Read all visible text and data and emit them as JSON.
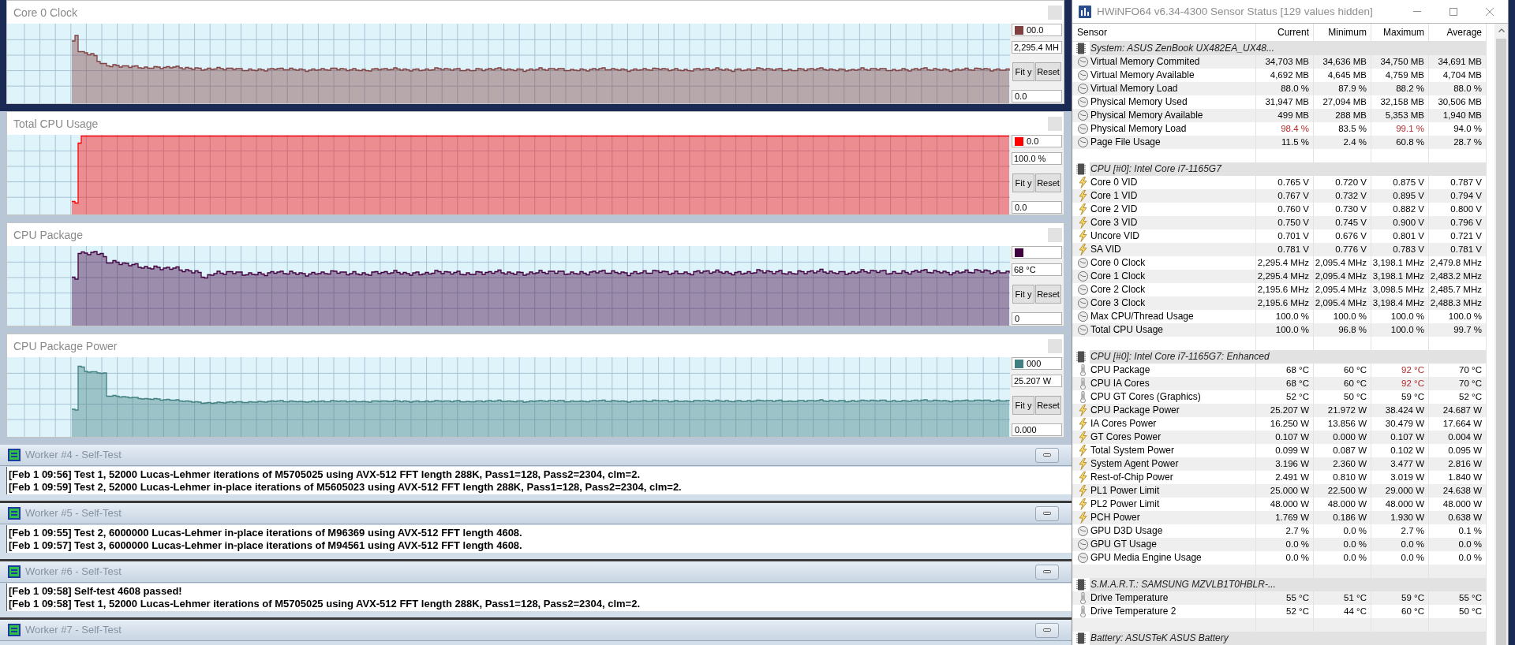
{
  "graphs": [
    {
      "title": "Core 0 Clock",
      "kind": "clock",
      "color": "#804040",
      "scale_max": "00.0",
      "current": "2,295.4 MH",
      "buttons": [
        "Fit y",
        "Reset"
      ],
      "scale_min": "0.0"
    },
    {
      "title": "Total CPU Usage",
      "kind": "usage",
      "color": "#ff0000",
      "scale_max": "0.0",
      "current": "100.0 %",
      "buttons": [
        "Fit y",
        "Reset"
      ],
      "scale_min": "0.0"
    },
    {
      "title": "CPU Package",
      "kind": "temperature",
      "color": "#400040",
      "current": "68 °C",
      "buttons": [
        "Fit y",
        "Reset"
      ],
      "scale_min": "0"
    },
    {
      "title": "CPU Package Power",
      "kind": "power",
      "color": "#408080",
      "scale_max": "000",
      "current": "25.207 W",
      "buttons": [
        "Fit y",
        "Reset"
      ],
      "scale_min": "0.000"
    }
  ],
  "workers": [
    {
      "title": "Worker #4 - Self-Test",
      "lines": [
        "[Feb 1 09:56] Test 1, 52000 Lucas-Lehmer iterations of M5705025 using AVX-512 FFT length 288K, Pass1=128, Pass2=2304, clm=2.",
        "[Feb 1 09:59] Test 2, 52000 Lucas-Lehmer in-place iterations of M5605023 using AVX-512 FFT length 288K, Pass1=128, Pass2=2304, clm=2."
      ]
    },
    {
      "title": "Worker #5 - Self-Test",
      "lines": [
        "[Feb 1 09:55] Test 2, 6000000 Lucas-Lehmer in-place iterations of M96369 using AVX-512 FFT length 4608.",
        "[Feb 1 09:57] Test 3, 6000000 Lucas-Lehmer in-place iterations of M94561 using AVX-512 FFT length 4608."
      ]
    },
    {
      "title": "Worker #6 - Self-Test",
      "lines": [
        "[Feb 1 09:58] Self-test 4608 passed!",
        "[Feb 1 09:58] Test 1, 52000 Lucas-Lehmer iterations of M5705025 using AVX-512 FFT length 288K, Pass1=128, Pass2=2304, clm=2."
      ]
    },
    {
      "title": "Worker #7 - Self-Test"
    }
  ],
  "hwinfo": {
    "title": "HWiNFO64 v6.34-4300 Sensor Status [129 values hidden]",
    "columns": [
      "Sensor",
      "Current",
      "Minimum",
      "Maximum",
      "Average"
    ],
    "sections": [
      {
        "name": "System: ASUS ZenBook UX482EA_UX48...",
        "rows": [
          {
            "kind": "meter",
            "name": "Virtual Memory Commited",
            "values": [
              "34,703 MB",
              "34,636 MB",
              "34,750 MB",
              "34,691 MB"
            ],
            "warnings": [
              false,
              false,
              false,
              false
            ]
          },
          {
            "kind": "meter",
            "name": "Virtual Memory Available",
            "values": [
              "4,692 MB",
              "4,645 MB",
              "4,759 MB",
              "4,704 MB"
            ],
            "warnings": [
              false,
              false,
              false,
              false
            ]
          },
          {
            "kind": "meter",
            "name": "Virtual Memory Load",
            "values": [
              "88.0 %",
              "87.9 %",
              "88.2 %",
              "88.0 %"
            ],
            "warnings": [
              false,
              false,
              false,
              false
            ]
          },
          {
            "kind": "meter",
            "name": "Physical Memory Used",
            "values": [
              "31,947 MB",
              "27,094 MB",
              "32,158 MB",
              "30,506 MB"
            ],
            "warnings": [
              false,
              false,
              false,
              false
            ]
          },
          {
            "kind": "meter",
            "name": "Physical Memory Available",
            "values": [
              "499 MB",
              "288 MB",
              "5,353 MB",
              "1,940 MB"
            ],
            "warnings": [
              false,
              false,
              false,
              false
            ]
          },
          {
            "kind": "meter",
            "name": "Physical Memory Load",
            "values": [
              "98.4 %",
              "83.5 %",
              "99.1 %",
              "94.0 %"
            ],
            "warnings": [
              true,
              false,
              true,
              false
            ]
          },
          {
            "kind": "meter",
            "name": "Page File Usage",
            "values": [
              "11.5 %",
              "2.4 %",
              "60.8 %",
              "28.7 %"
            ],
            "warnings": [
              false,
              false,
              false,
              false
            ]
          }
        ]
      },
      {
        "name": "CPU [#0]: Intel Core i7-1165G7",
        "rows": [
          {
            "kind": "electric",
            "name": "Core 0 VID",
            "values": [
              "0.765 V",
              "0.720 V",
              "0.875 V",
              "0.787 V"
            ],
            "warnings": [
              false,
              false,
              false,
              false
            ]
          },
          {
            "kind": "electric",
            "name": "Core 1 VID",
            "values": [
              "0.767 V",
              "0.732 V",
              "0.895 V",
              "0.794 V"
            ],
            "warnings": [
              false,
              false,
              false,
              false
            ]
          },
          {
            "kind": "electric",
            "name": "Core 2 VID",
            "values": [
              "0.760 V",
              "0.730 V",
              "0.882 V",
              "0.800 V"
            ],
            "warnings": [
              false,
              false,
              false,
              false
            ]
          },
          {
            "kind": "electric",
            "name": "Core 3 VID",
            "values": [
              "0.750 V",
              "0.745 V",
              "0.900 V",
              "0.796 V"
            ],
            "warnings": [
              false,
              false,
              false,
              false
            ]
          },
          {
            "kind": "electric",
            "name": "Uncore VID",
            "values": [
              "0.701 V",
              "0.676 V",
              "0.801 V",
              "0.721 V"
            ],
            "warnings": [
              false,
              false,
              false,
              false
            ]
          },
          {
            "kind": "electric",
            "name": "SA VID",
            "values": [
              "0.781 V",
              "0.776 V",
              "0.783 V",
              "0.781 V"
            ],
            "warnings": [
              false,
              false,
              false,
              false
            ]
          },
          {
            "kind": "meter",
            "name": "Core 0 Clock",
            "values": [
              "2,295.4 MHz",
              "2,095.4 MHz",
              "3,198.1 MHz",
              "2,479.8 MHz"
            ],
            "warnings": [
              false,
              false,
              false,
              false
            ]
          },
          {
            "kind": "meter",
            "name": "Core 1 Clock",
            "values": [
              "2,295.4 MHz",
              "2,095.4 MHz",
              "3,198.1 MHz",
              "2,483.2 MHz"
            ],
            "warnings": [
              false,
              false,
              false,
              false
            ]
          },
          {
            "kind": "meter",
            "name": "Core 2 Clock",
            "values": [
              "2,195.6 MHz",
              "2,095.4 MHz",
              "3,098.5 MHz",
              "2,485.7 MHz"
            ],
            "warnings": [
              false,
              false,
              false,
              false
            ]
          },
          {
            "kind": "meter",
            "name": "Core 3 Clock",
            "values": [
              "2,195.6 MHz",
              "2,095.4 MHz",
              "3,198.4 MHz",
              "2,488.3 MHz"
            ],
            "warnings": [
              false,
              false,
              false,
              false
            ]
          },
          {
            "kind": "meter",
            "name": "Max CPU/Thread Usage",
            "values": [
              "100.0 %",
              "100.0 %",
              "100.0 %",
              "100.0 %"
            ],
            "warnings": [
              false,
              false,
              false,
              false
            ]
          },
          {
            "kind": "meter",
            "name": "Total CPU Usage",
            "values": [
              "100.0 %",
              "96.8 %",
              "100.0 %",
              "99.7 %"
            ],
            "warnings": [
              false,
              false,
              false,
              false
            ]
          }
        ]
      },
      {
        "name": "CPU [#0]: Intel Core i7-1165G7: Enhanced",
        "rows": [
          {
            "kind": "thermal",
            "name": "CPU Package",
            "values": [
              "68 °C",
              "60 °C",
              "92 °C",
              "70 °C"
            ],
            "warnings": [
              false,
              false,
              true,
              false
            ]
          },
          {
            "kind": "thermal",
            "name": "CPU IA Cores",
            "values": [
              "68 °C",
              "60 °C",
              "92 °C",
              "70 °C"
            ],
            "warnings": [
              false,
              false,
              true,
              false
            ]
          },
          {
            "kind": "thermal",
            "name": "CPU GT Cores (Graphics)",
            "values": [
              "52 °C",
              "50 °C",
              "59 °C",
              "52 °C"
            ],
            "warnings": [
              false,
              false,
              false,
              false
            ]
          },
          {
            "kind": "electric",
            "name": "CPU Package Power",
            "values": [
              "25.207 W",
              "21.972 W",
              "38.424 W",
              "24.687 W"
            ],
            "warnings": [
              false,
              false,
              false,
              false
            ]
          },
          {
            "kind": "electric",
            "name": "IA Cores Power",
            "values": [
              "16.250 W",
              "13.856 W",
              "30.479 W",
              "17.664 W"
            ],
            "warnings": [
              false,
              false,
              false,
              false
            ]
          },
          {
            "kind": "electric",
            "name": "GT Cores Power",
            "values": [
              "0.107 W",
              "0.000 W",
              "0.107 W",
              "0.004 W"
            ],
            "warnings": [
              false,
              false,
              false,
              false
            ]
          },
          {
            "kind": "electric",
            "name": "Total System Power",
            "values": [
              "0.099 W",
              "0.087 W",
              "0.102 W",
              "0.095 W"
            ],
            "warnings": [
              false,
              false,
              false,
              false
            ]
          },
          {
            "kind": "electric",
            "name": "System Agent Power",
            "values": [
              "3.196 W",
              "2.360 W",
              "3.477 W",
              "2.816 W"
            ],
            "warnings": [
              false,
              false,
              false,
              false
            ]
          },
          {
            "kind": "electric",
            "name": "Rest-of-Chip Power",
            "values": [
              "2.491 W",
              "0.810 W",
              "3.019 W",
              "1.840 W"
            ],
            "warnings": [
              false,
              false,
              false,
              false
            ]
          },
          {
            "kind": "electric",
            "name": "PL1 Power Limit",
            "values": [
              "25.000 W",
              "22.500 W",
              "29.000 W",
              "24.638 W"
            ],
            "warnings": [
              false,
              false,
              false,
              false
            ]
          },
          {
            "kind": "electric",
            "name": "PL2 Power Limit",
            "values": [
              "48.000 W",
              "48.000 W",
              "48.000 W",
              "48.000 W"
            ],
            "warnings": [
              false,
              false,
              false,
              false
            ]
          },
          {
            "kind": "electric",
            "name": "PCH Power",
            "values": [
              "1.769 W",
              "0.186 W",
              "1.930 W",
              "0.638 W"
            ],
            "warnings": [
              false,
              false,
              false,
              false
            ]
          },
          {
            "kind": "meter",
            "name": "GPU D3D Usage",
            "values": [
              "2.7 %",
              "0.0 %",
              "2.7 %",
              "0.1 %"
            ],
            "warnings": [
              false,
              false,
              false,
              false
            ]
          },
          {
            "kind": "meter",
            "name": "GPU GT Usage",
            "values": [
              "0.0 %",
              "0.0 %",
              "0.0 %",
              "0.0 %"
            ],
            "warnings": [
              false,
              false,
              false,
              false
            ]
          },
          {
            "kind": "meter",
            "name": "GPU Media Engine Usage",
            "values": [
              "0.0 %",
              "0.0 %",
              "0.0 %",
              "0.0 %"
            ],
            "warnings": [
              false,
              false,
              false,
              false
            ]
          }
        ]
      },
      {
        "name": "S.M.A.R.T.: SAMSUNG MZVLB1T0HBLR-...",
        "rows": [
          {
            "kind": "thermal",
            "name": "Drive Temperature",
            "values": [
              "55 °C",
              "51 °C",
              "59 °C",
              "55 °C"
            ],
            "warnings": [
              false,
              false,
              false,
              false
            ]
          },
          {
            "kind": "thermal",
            "name": "Drive Temperature 2",
            "values": [
              "52 °C",
              "44 °C",
              "60 °C",
              "50 °C"
            ],
            "warnings": [
              false,
              false,
              false,
              false
            ]
          }
        ]
      },
      {
        "name": "Battery: ASUSTeK ASUS Battery"
      }
    ]
  }
}
